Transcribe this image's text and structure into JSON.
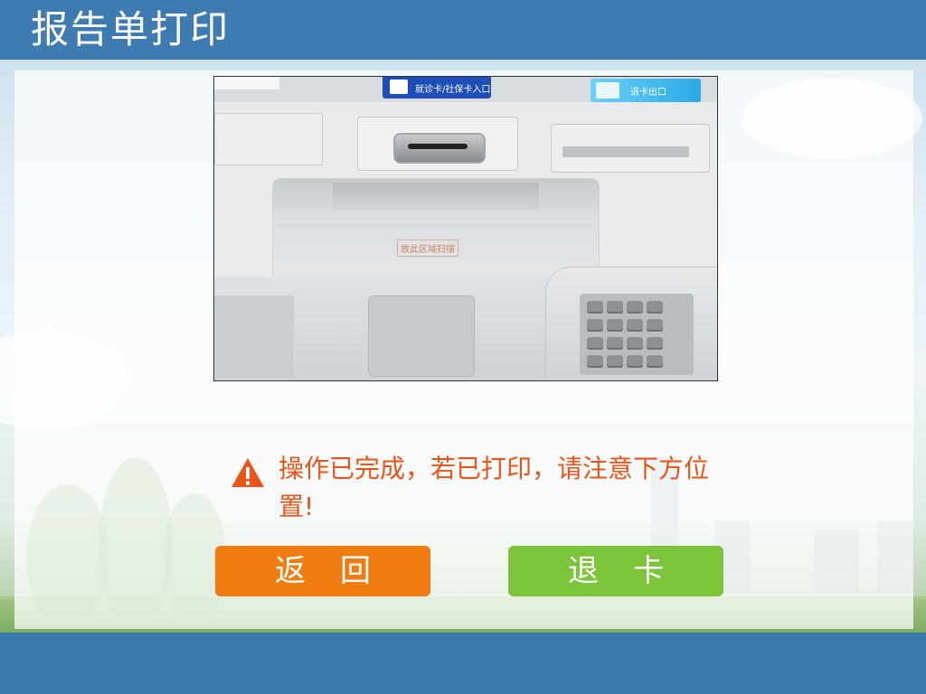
{
  "header": {
    "title": "报告单打印"
  },
  "photo": {
    "card_label": "就诊卡/社保卡入口",
    "right_label": "退卡出口",
    "scan_text": "放此区域扫描"
  },
  "message": {
    "text": "操作已完成，若已打印，请注意下方位置!",
    "icon": "warning-triangle-icon",
    "color": "#e8541a"
  },
  "buttons": {
    "back_label": "返回",
    "exit_label": "退卡",
    "back_color": "#f07d11",
    "exit_color": "#7cc43a"
  },
  "theme": {
    "header_color": "#3d7bb0",
    "footer_color": "#3b78ab"
  }
}
